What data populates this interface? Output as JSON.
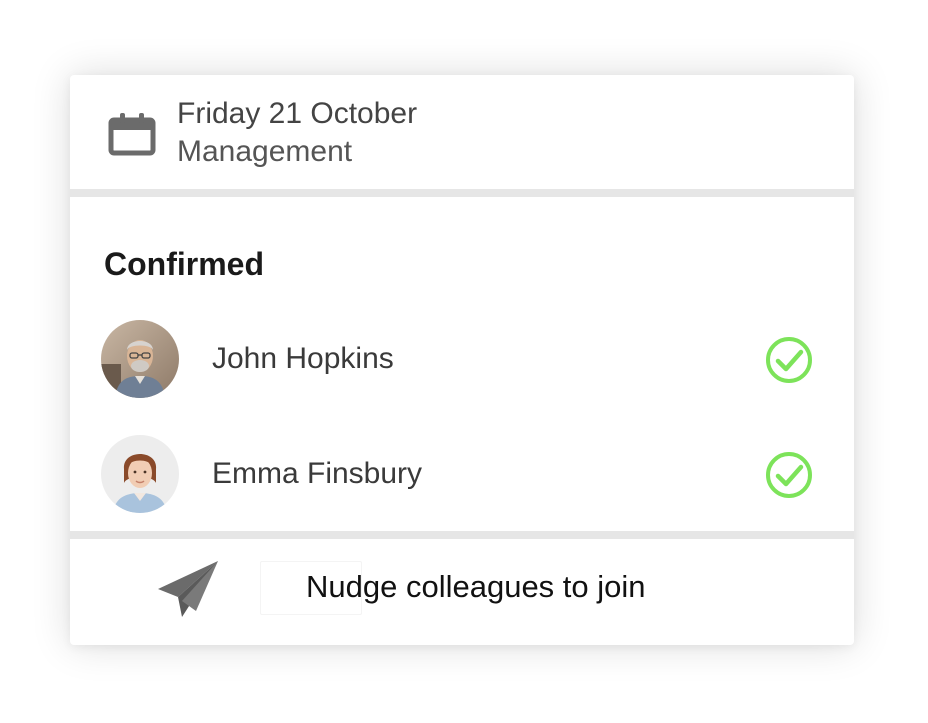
{
  "event": {
    "date": "Friday 21 October",
    "category": "Management",
    "icon": "calendar-icon"
  },
  "confirmed": {
    "title": "Confirmed",
    "attendees": [
      {
        "name": "John Hopkins",
        "status": "confirmed",
        "status_icon": "check-circle-icon"
      },
      {
        "name": "Emma Finsbury",
        "status": "confirmed",
        "status_icon": "check-circle-icon"
      }
    ]
  },
  "footer": {
    "nudge_label": "Nudge colleagues to join",
    "icon": "paper-plane-icon"
  },
  "colors": {
    "confirmed_check": "#7de35a",
    "icon_gray": "#6b6b6b",
    "divider": "#e6e6e6"
  }
}
